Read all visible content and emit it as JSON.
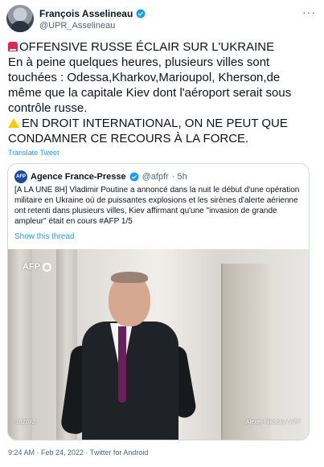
{
  "author": {
    "display_name": "François Asselineau",
    "handle": "@UPR_Asselineau",
    "more_icon": "more-icon"
  },
  "tweet": {
    "lines": [
      "OFFENSIVE RUSSE ÉCLAIR SUR L'UKRAINE",
      "En à peine quelques heures, plusieurs villes sont",
      "touchées : Odessa,Kharkov,Marioupol, Kherson,de",
      "même que la capitale Kiev dont l'aéroport serait sous",
      "contrôle russe.",
      "EN DROIT INTERNATIONAL, ON NE PEUT QUE",
      "CONDAMNER CE RECOURS À LA FORCE."
    ],
    "translate_label": "Translate Tweet"
  },
  "quoted": {
    "avatar_label": "AFP",
    "name": "Agence France-Presse",
    "handle": "@afpfr",
    "time": "· 5h",
    "lines": [
      "[A LA UNE 8H] Vladimir Poutine a annoncé dans la nuit le début d'une opération",
      "militaire en Ukraine où de puissantes explosions et les sirènes d'alerte aérienne",
      "ont retenti dans plusieurs villes, Kiev affirmant qu'une \"invasion de grande",
      "ampleur\" était en cours #AFP 1/5"
    ],
    "show_thread": "Show this thread",
    "photo": {
      "logo_text": "AFP",
      "code": "18Z07Z",
      "credit": "Alexey Nikolsky / AFP"
    }
  },
  "meta": {
    "text": "9:24 AM · Feb 24, 2022 · Twitter for Android"
  },
  "colors": {
    "link": "#1d9bf0",
    "secondary": "#536471",
    "text": "#0f1419",
    "border": "#cfd9de"
  }
}
